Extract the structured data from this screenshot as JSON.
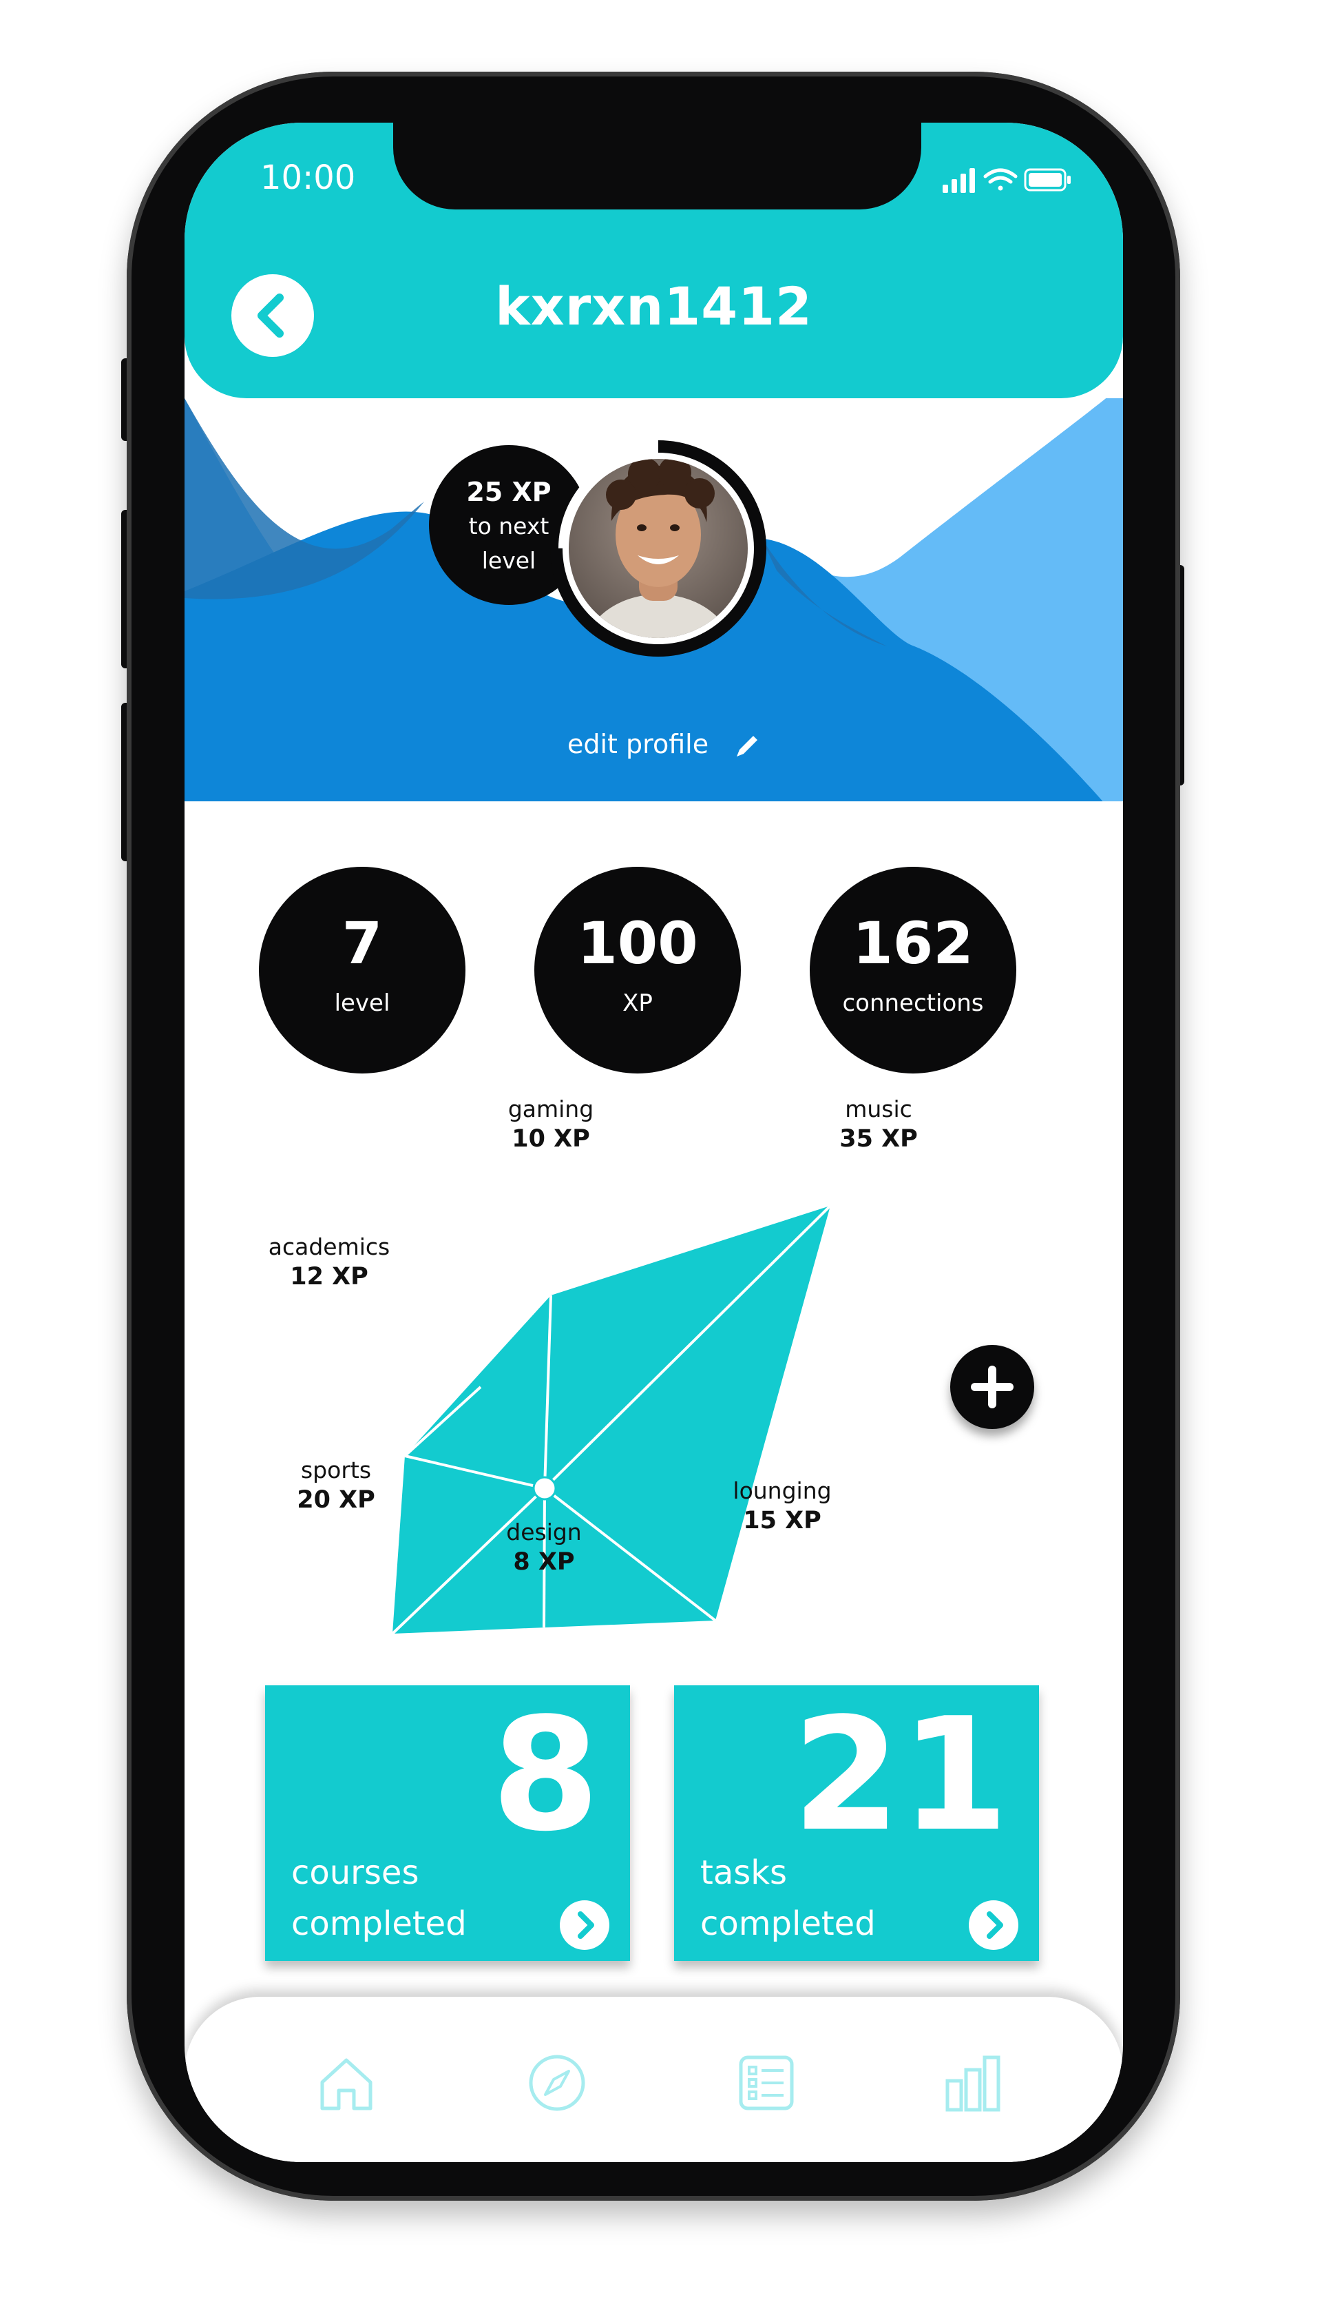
{
  "status_bar": {
    "time": "10:00",
    "icons": [
      "signal-icon",
      "wifi-icon",
      "battery-icon"
    ]
  },
  "header": {
    "username": "kxrxn1412",
    "back_icon": "chevron-left-icon"
  },
  "profile": {
    "xp_to_next": {
      "value": "25 XP",
      "line1": "to next",
      "line2": "level"
    },
    "level_progress_fraction": 0.75,
    "edit_label": "edit profile",
    "edit_icon": "pencil-icon"
  },
  "stats": [
    {
      "value": "7",
      "label": "level"
    },
    {
      "value": "100",
      "label": "XP"
    },
    {
      "value": "162",
      "label": "connections"
    }
  ],
  "skills": [
    {
      "name": "gaming",
      "xp": "10 XP"
    },
    {
      "name": "music",
      "xp": "35 XP"
    },
    {
      "name": "academics",
      "xp": "12 XP"
    },
    {
      "name": "sports",
      "xp": "20 XP"
    },
    {
      "name": "design",
      "xp": "8 XP"
    },
    {
      "name": "lounging",
      "xp": "15 XP"
    }
  ],
  "cards": [
    {
      "number": "8",
      "line1": "courses",
      "line2": "completed"
    },
    {
      "number": "21",
      "line1": "tasks",
      "line2": "completed"
    }
  ],
  "nav": {
    "items": [
      "home-icon",
      "compass-icon",
      "list-icon",
      "bar-chart-icon"
    ]
  },
  "colors": {
    "teal": "#13cbcf",
    "wave_dark": "#0e86d8",
    "wave_light": "#64bbf7",
    "black": "#0a0a0b"
  }
}
